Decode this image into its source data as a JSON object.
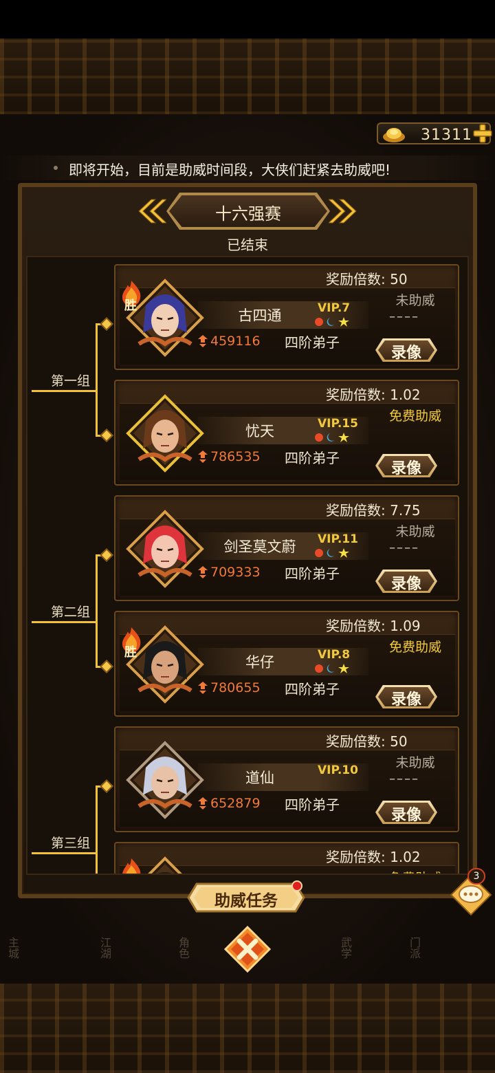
{
  "currency": {
    "value": "31311",
    "icon": "gold-ingot-icon",
    "add_icon": "plus-icon"
  },
  "notice": "即将开始，目前是助威时间段，大侠们赶紧去助威吧!",
  "round": {
    "title": "十六强赛",
    "status": "已结束"
  },
  "groups": [
    {
      "label": "第一组"
    },
    {
      "label": "第二组"
    },
    {
      "label": "第三组"
    }
  ],
  "players": [
    {
      "multiplier": "奖励倍数: 50",
      "name": "古四通",
      "vip": "VIP.7",
      "power": "459116",
      "rank": "四阶弟子",
      "support": "未助威",
      "dashes": "––––",
      "winner": true,
      "record": "录像"
    },
    {
      "multiplier": "奖励倍数: 1.02",
      "name": "忧天",
      "vip": "VIP.15",
      "power": "786535",
      "rank": "四阶弟子",
      "support": "免费助威",
      "winner": false,
      "record": "录像"
    },
    {
      "multiplier": "奖励倍数: 7.75",
      "name": "剑圣莫文蔚",
      "vip": "VIP.11",
      "power": "709333",
      "rank": "四阶弟子",
      "support": "未助威",
      "dashes": "––––",
      "winner": false,
      "record": "录像"
    },
    {
      "multiplier": "奖励倍数: 1.09",
      "name": "华仔",
      "vip": "VIP.8",
      "power": "780655",
      "rank": "四阶弟子",
      "support": "免费助威",
      "winner": true,
      "record": "录像"
    },
    {
      "multiplier": "奖励倍数: 50",
      "name": "道仙",
      "vip": "VIP.10",
      "power": "652879",
      "rank": "四阶弟子",
      "support": "未助威",
      "dashes": "––––",
      "winner": false,
      "record": "录像"
    },
    {
      "multiplier": "奖励倍数: 1.02",
      "support": "免费助威",
      "winner": true
    }
  ],
  "win_badge": "胜",
  "buttons": {
    "task": "助威任务",
    "close_icon": "close-x-icon",
    "chat_icon": "chat-bubble-icon",
    "chat_count": "3"
  },
  "dock": [
    "主城",
    "江湖",
    "角色",
    "武学",
    "门派"
  ],
  "colors": {
    "gold": "#f3c93c",
    "power": "#ef7a3a",
    "panel_border": "#5a3e1c",
    "bracket": "#f2c23a"
  }
}
